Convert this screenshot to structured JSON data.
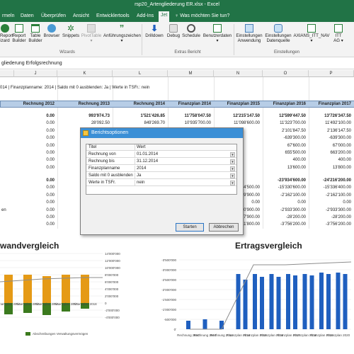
{
  "window": {
    "title": "rsp20_Artengliederung ER.xlsx - Excel"
  },
  "tabs": [
    {
      "label": "rmeln"
    },
    {
      "label": "Daten"
    },
    {
      "label": "Überprüfen"
    },
    {
      "label": "Ansicht"
    },
    {
      "label": "Entwicklertools"
    },
    {
      "label": "Add-Ins"
    },
    {
      "label": "Jet"
    }
  ],
  "tell_me": "♀ Was möchten Sie tun?",
  "ribbon": {
    "buttons": [
      {
        "line1": "Report",
        "line2": "izard"
      },
      {
        "line1": "Report",
        "line2": "Builder"
      },
      {
        "line1": "Table",
        "line2": "Builder"
      },
      {
        "line1": "Browser",
        "line2": ""
      },
      {
        "line1": "Snippets",
        "line2": ""
      },
      {
        "line1": "PivotTable",
        "line2": "▾"
      },
      {
        "line1": "Anführungszeichen",
        "line2": "▾"
      },
      {
        "line1": "Drilldown",
        "line2": ""
      },
      {
        "line1": "Debug",
        "line2": ""
      },
      {
        "line1": "Schedule",
        "line2": ""
      },
      {
        "line1": "Benutzerdaten",
        "line2": "▾"
      },
      {
        "line1": "Einstellungen",
        "line2": "Anwendung"
      },
      {
        "line1": "Einstellungen",
        "line2": "Datenquelle"
      },
      {
        "line1": "AXIANS_ITT_NAV",
        "line2": "▾"
      },
      {
        "line1": "ITT",
        "line2": "AG ▾"
      }
    ],
    "groups": [
      "Wizards",
      "Extras Bericht",
      "Einstellungen"
    ]
  },
  "formula_bar": {
    "text": "gliederung Erfolgsrechnung"
  },
  "sheet": {
    "col_letters": [
      "J",
      "K",
      "L",
      "M",
      "N",
      "O",
      "P"
    ],
    "info_line": "014 | Finanzplanname: 2014 | Saldo mit 0 ausblenden: Ja | Werte in TSFr.: nein",
    "headers": [
      "Rechnung 2012",
      "Rechnung 2013",
      "Rechnung 2014",
      "Finanzplan 2014",
      "Finanzplan 2015",
      "Finanzplan 2016",
      "Finanzplan 2017"
    ],
    "rows_top": [
      [
        "0.00",
        "993'974.73",
        "1'521'426.85",
        "11'758'047.50",
        "12'215'147.50",
        "12'599'447.50",
        "13'726'347.50"
      ],
      [
        "0.00",
        "28'092.50",
        "849'269.70",
        "10'935'700.00",
        "11'098'600.00",
        "11'323'700.00",
        "11'492'100.00"
      ],
      [
        "0.00",
        "",
        "",
        "",
        "",
        "2'101'847.50",
        "2'136'147.50"
      ],
      [
        "0.00",
        "",
        "",
        "",
        "",
        "-639'300.00",
        "-639'300.00"
      ],
      [
        "0.00",
        "",
        "",
        "",
        "",
        "67'600.00",
        "67'000.00"
      ],
      [
        "0.00",
        "",
        "",
        "",
        "",
        "655'500.00",
        "663'200.00"
      ],
      [
        "0.00",
        "",
        "",
        "",
        "",
        "400.00",
        "400.00"
      ],
      [
        "0.00",
        "",
        "",
        "",
        "",
        "13'600.00",
        "13'800.00"
      ]
    ],
    "rows_bottom": [
      [
        "0.00",
        "",
        "",
        "",
        "",
        "-23'934'600.00",
        "-24'216'200.00"
      ],
      [
        "0.00",
        "",
        "",
        "",
        "-15'154'500.00",
        "-15'330'600.00",
        "-15'336'400.00"
      ],
      [
        "0.00",
        "",
        "",
        "",
        "-2'139'900.00",
        "-2'162'100.00",
        "-2'162'100.00"
      ],
      [
        "0.00",
        "",
        "",
        "",
        "0.00",
        "0.00",
        "0.00"
      ],
      [
        "0.00",
        "",
        "",
        "",
        "-2'900'900.00",
        "-2'933'300.00",
        "-2'933'300.00"
      ],
      [
        "0.00",
        "",
        "",
        "",
        "-27'900.00",
        "-28'200.00",
        "-28'200.00"
      ],
      [
        "0.00",
        "",
        "",
        "",
        "-3'711'800.00",
        "-3'756'200.00",
        "-3'756'200.00"
      ]
    ],
    "left_frag": "en"
  },
  "charts": {
    "left_title": "wandvergleich",
    "left_legend": "Abschreibungen Verwaltungsvermögen",
    "left_xcats": [
      "Finanzplan 2014",
      "Finanzplan 2015",
      "Finanzplan 2016",
      "Finanzplan 2017",
      "Finanzplan 2018"
    ],
    "right_title": "Ertragsvergleich",
    "right_yaxis": [
      "0'",
      "-500'000",
      "-1'000'000",
      "-1'500'000",
      "-2'000'000",
      "-2'500'000",
      "-3'000'000",
      "-3'500'000"
    ],
    "left_yaxis": [
      "14'000'000",
      "12'000'000",
      "10'000'000",
      "8'000'000",
      "6'000'000",
      "4'000'000",
      "2'000'000",
      "0",
      "-2'000'000",
      "-4'000'000"
    ],
    "right_xcats": [
      "Rechnung 2012",
      "Rechnung 2013",
      "Rechnung 2014",
      "Finanzplan 2014",
      "Finanzplan 2015",
      "Finanzplan 2016",
      "Finanzplan 2017",
      "Finanzplan 2018",
      "Finanzplan 2019",
      "Finanzplan 2020"
    ],
    "colors": {
      "orange": "#e59a16",
      "green": "#3b7a1e",
      "blue": "#1f5fbf",
      "gray": "#8c8c8c"
    }
  },
  "dialog": {
    "title": "Berichtsoptionen",
    "col_title": "Titel",
    "col_value": "Wert",
    "rows": [
      {
        "key": "Rechnung von",
        "value": "01.01.2014"
      },
      {
        "key": "Rechnung bis",
        "value": "31.12.2014"
      },
      {
        "key": "Finanzplanname",
        "value": "2014"
      },
      {
        "key": "Saldo mit 0 ausblenden",
        "value": "Ja"
      },
      {
        "key": "Werte in TSFr.",
        "value": "nein"
      }
    ],
    "start_label": "Starten",
    "cancel_label": "Abbrechen"
  }
}
